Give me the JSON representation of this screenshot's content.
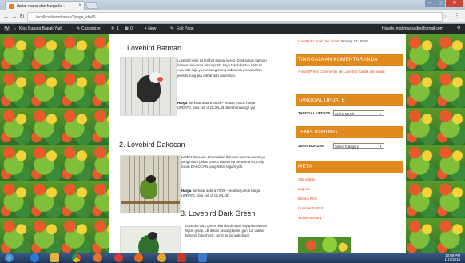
{
  "browser": {
    "tab_title": "daftar nama dan harga lo...",
    "tab_close": "×",
    "url": "localhost/wordpress/?page_id=45"
  },
  "adminbar": {
    "site": "Kios Burung Bapak Yadi",
    "customize": "Customize",
    "comments_count": "1",
    "updates_count": "0",
    "new": "+ New",
    "edit": "Edit Page",
    "howdy": "Howdy, mahmudsadie@gmail.com"
  },
  "main": {
    "sections": [
      {
        "title": "1. Lovebird Batman",
        "desc": "Lovebird jenis ini terlihat sangat keren. Dinamakan batman karena berwarna hitam putih, kaya tokoh kartun batman. Ada-ada saja ya memang orang Indonesia menamakan jenis burung jika dilihat dari warnanya.",
        "price_label": "Harga",
        "price": ": berkisar antara 850rb+ keatas (untuk harga UPDATE, bisa cek di OLX/LJB daerah masing2 ya)"
      },
      {
        "title": "2. Lovebird Dakocan",
        "desc": "Lakbet dakocan. Dinamakan dakocan karena mukanya yang hitam pekat namun badannya berwarna ijo, mirip tokoh DAKOCAN yang hitam legam yeh.",
        "price_label": "Harga",
        "price": ": berkisar antara 700rb – keatas (untuk harga UPDATE, bisa cek di OLX/LJB)"
      },
      {
        "title": "3. Lovebird Dark Green",
        "desc": "Lovebird dark green ditandai dengan sayap berwarna hijam gelap. LB diatas sedang birahi gan. LB diatas berjenis blackheck. Jenis ini banyak dijual."
      }
    ]
  },
  "sidebar": {
    "recent_post_link": "LoveBird Cantik dan indah",
    "recent_post_date": "January 17, 2018",
    "comments_title": "TINGGALKAN KOMENTARANDA",
    "comment_author": "A WordPress Commenter",
    "comment_on": "on",
    "comment_link": "LoveBird Cantik dan indah",
    "update_title": "TANGGAL UPDATE",
    "update_label": "TANGGAL UPDATE",
    "update_select": "Select Month",
    "jenis_title": "JENIS BURUNG",
    "jenis_label": "JENIS BURUNG",
    "jenis_select": "Select Category",
    "meta_title": "META",
    "meta_links": [
      "Site Admin",
      "Log out",
      "Entries RSS",
      "Comments RSS",
      "WordPress.org"
    ]
  },
  "taskbar": {
    "time": "10:09 PM",
    "date": "1/17/2018"
  },
  "colors": {
    "accent": "#e08a1e",
    "link": "#e04a1a",
    "adminbar": "#23282d",
    "taskbar": "#1f3659"
  }
}
